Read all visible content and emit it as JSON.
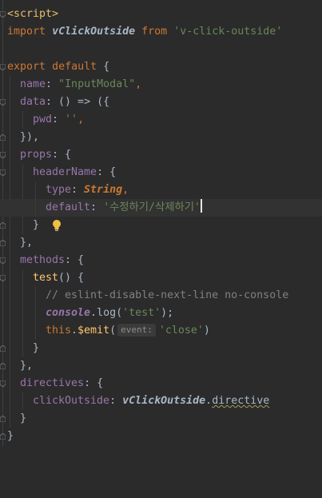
{
  "editor": {
    "lines": {
      "l1": {
        "tag_open": "<script>"
      },
      "l2": {
        "kw_import": "import",
        "ident": "vClickOutside",
        "kw_from": "from",
        "module": "'v-click-outside'"
      },
      "l4": {
        "kw_export": "export",
        "kw_default": "default",
        "brace": "{"
      },
      "l5": {
        "key": "name",
        "colon": ": ",
        "value": "\"InputModal\"",
        "comma": ","
      },
      "l6": {
        "key": "data",
        "rest": ": () => ({"
      },
      "l7": {
        "key": "pwd",
        "colon": ": ",
        "value": "''",
        "comma": ","
      },
      "l8": {
        "text": "}),"
      },
      "l9": {
        "key": "props",
        "rest": ": {"
      },
      "l10": {
        "key": "headerName",
        "rest": ": {"
      },
      "l11": {
        "key": "type",
        "colon": ": ",
        "value": "String",
        "comma": ","
      },
      "l12": {
        "key": "default",
        "colon": ": ",
        "value": "'수정하기/삭제하기'"
      },
      "l13": {
        "text": "}"
      },
      "l14": {
        "text": "},"
      },
      "l15": {
        "key": "methods",
        "rest": ": {"
      },
      "l16": {
        "fn": "test",
        "rest": "() {"
      },
      "l17": {
        "comment": "// eslint-disable-next-line no-console"
      },
      "l18": {
        "obj": "console",
        "dot": ".",
        "method": "log",
        "open": "(",
        "arg": "'test'",
        "close": ");"
      },
      "l19": {
        "kw_this": "this",
        "dot": ".",
        "method": "$emit",
        "open": "(",
        "hint": "event:",
        "arg": "'close'",
        "close": ")"
      },
      "l20": {
        "text": "}"
      },
      "l21": {
        "text": "},"
      },
      "l22": {
        "key": "directives",
        "rest": ": {"
      },
      "l23": {
        "key": "clickOutside",
        "colon": ": ",
        "obj": "vClickOutside",
        "dot": ".",
        "prop": "directive"
      },
      "l24": {
        "text": "}"
      },
      "l25": {
        "text": "}"
      }
    }
  }
}
